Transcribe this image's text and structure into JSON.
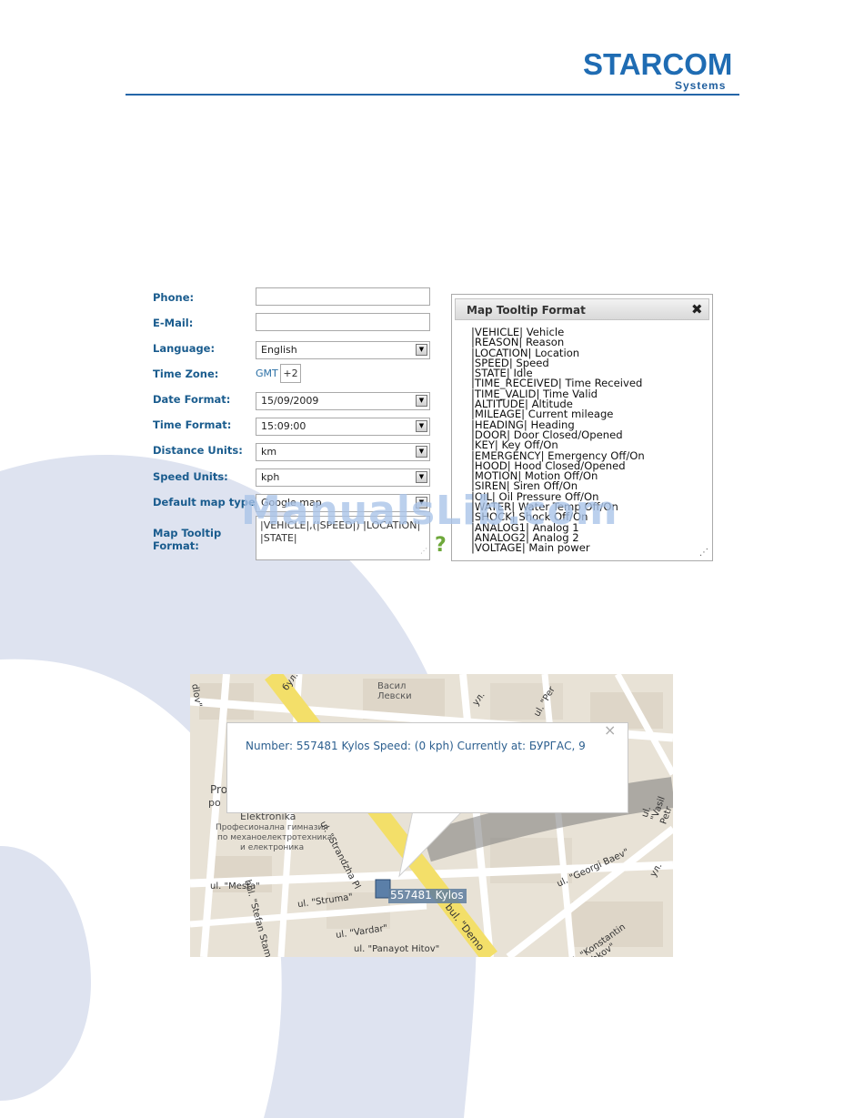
{
  "header": {
    "logo_main": "STARCOM",
    "logo_sub": "Systems"
  },
  "form": {
    "phone_label": "Phone:",
    "email_label": "E-Mail:",
    "language_label": "Language:",
    "language_value": "English",
    "timezone_label": "Time Zone:",
    "timezone_prefix": "GMT",
    "timezone_value": "+2",
    "date_format_label": "Date Format:",
    "date_format_value": "15/09/2009",
    "time_format_label": "Time Format:",
    "time_format_value": "15:09:00",
    "distance_units_label": "Distance Units:",
    "distance_units_value": "km",
    "speed_units_label": "Speed Units:",
    "speed_units_value": "kph",
    "default_map_label": "Default map type:",
    "default_map_value": "Google map",
    "tooltip_format_label_1": "Map Tooltip",
    "tooltip_format_label_2": "Format:",
    "tooltip_format_line1": "|VEHICLE|,(|SPEED|) |LOCATION|",
    "tooltip_format_line2": "|STATE|",
    "help_glyph": "?"
  },
  "tooltip_panel": {
    "title": "Map Tooltip Format",
    "close_glyph": "✖",
    "items": [
      "|VEHICLE| Vehicle",
      "|REASON| Reason",
      "|LOCATION| Location",
      "|SPEED| Speed",
      "|STATE| Idle",
      "|TIME_RECEIVED| Time Received",
      "|TIME_VALID| Time Valid",
      "|ALTITUDE| Altitude",
      "|MILEAGE| Current mileage",
      "|HEADING| Heading",
      "|DOOR| Door Closed/Opened",
      "|KEY| Key Off/On",
      "|EMERGENCY| Emergency Off/On",
      "|HOOD| Hood Closed/Opened",
      "|MOTION| Motion Off/On",
      "|SIREN| Siren Off/On",
      "|OIL| Oil Pressure Off/On",
      "|WATER| Water Temp Off/On",
      "|SHOCK| Shock Off/On",
      "|ANALOG1| Analog 1",
      "|ANALOG2| Analog 2",
      "|VOLTAGE| Main power"
    ]
  },
  "map": {
    "bubble_text": "Number: 557481 Kylos Speed: (0 kph) Currently at: БУРГАС, 9",
    "bubble_close": "×",
    "marker_label": "557481 Kylos",
    "streets": {
      "blvd_dem_top": "бул. \"Дем",
      "vasil": "Васил",
      "levski": "Левски",
      "ul_top": "ул.",
      "ul_per": "ul. \"Per",
      "vasil_petr": "ul. \"Vasil Petr",
      "prof": "Prof",
      "po": "po",
      "elektronika": "Elektronika",
      "prof_bg1": "Професионална гимназия",
      "prof_bg2": "по механоелектротехника",
      "prof_bg3": "и електроника",
      "strandzha": "ul. \"Strandzha Pl",
      "mesta": "ul. \"Mesta\"",
      "struma": "ul. \"Struma\"",
      "stefan": "bul. \"Stefan Stambol",
      "vardar": "ul. \"Vardar\"",
      "panayot": "ul. \"Panayot Hitov\"",
      "blvd_demo": "bul. \"Demo",
      "georgi": "ul. \"Georgi Baev\"",
      "konstantin": "ul. \"Konstantin Velichkov\"",
      "ul_right": "ул.",
      "ul_left": "dlov\""
    }
  },
  "watermark": "ManualsLib.com",
  "colors": {
    "brand_blue": "#1f6cb3",
    "label_blue": "#1a5c8e",
    "bg_swirl": "#dde3f0",
    "map_road_yellow": "#f4e06a"
  }
}
